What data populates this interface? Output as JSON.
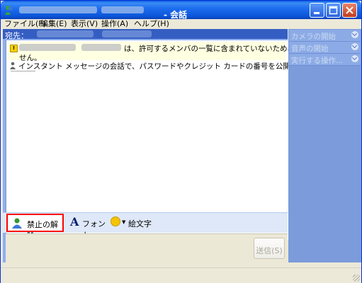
{
  "window": {
    "title_suffix": "- 会話"
  },
  "menu": {
    "items": [
      "ファイル(F)",
      "編集(E)",
      "表示(V)",
      "操作(A)",
      "ヘルプ(H)"
    ]
  },
  "to_bar": {
    "label": "宛先："
  },
  "history": {
    "warning_line1": "は、許可するメンバの一覧に含まれていないため、送信できま",
    "warning_line2": "せん。",
    "info_message": "インスタント メッセージの会話で、パスワードやクレジット カードの番号を公開しないでください。"
  },
  "toolbar": {
    "unblock_label": "禁止の解除",
    "font_label": "フォント",
    "emoticon_label": "絵文字"
  },
  "compose": {
    "send_label": "送信(S)"
  },
  "side_panel": {
    "items": [
      "カメラの開始",
      "音声の開始",
      "実行する操作..."
    ]
  },
  "colors": {
    "unblock_highlight": "#ff0000",
    "titlebar": "#0c55d8",
    "panel": "#7b9bdb"
  }
}
